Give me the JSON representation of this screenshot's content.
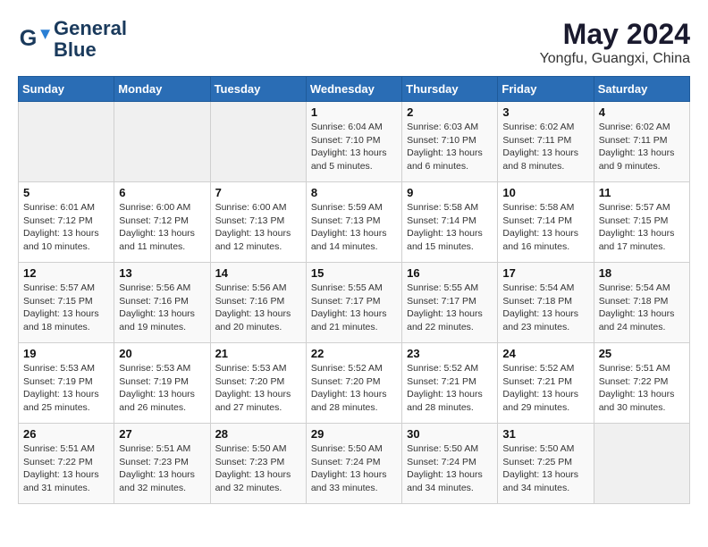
{
  "logo": {
    "line1": "General",
    "line2": "Blue"
  },
  "title": "May 2024",
  "location": "Yongfu, Guangxi, China",
  "days_header": [
    "Sunday",
    "Monday",
    "Tuesday",
    "Wednesday",
    "Thursday",
    "Friday",
    "Saturday"
  ],
  "weeks": [
    [
      {
        "day": "",
        "info": ""
      },
      {
        "day": "",
        "info": ""
      },
      {
        "day": "",
        "info": ""
      },
      {
        "day": "1",
        "info": "Sunrise: 6:04 AM\nSunset: 7:10 PM\nDaylight: 13 hours\nand 5 minutes."
      },
      {
        "day": "2",
        "info": "Sunrise: 6:03 AM\nSunset: 7:10 PM\nDaylight: 13 hours\nand 6 minutes."
      },
      {
        "day": "3",
        "info": "Sunrise: 6:02 AM\nSunset: 7:11 PM\nDaylight: 13 hours\nand 8 minutes."
      },
      {
        "day": "4",
        "info": "Sunrise: 6:02 AM\nSunset: 7:11 PM\nDaylight: 13 hours\nand 9 minutes."
      }
    ],
    [
      {
        "day": "5",
        "info": "Sunrise: 6:01 AM\nSunset: 7:12 PM\nDaylight: 13 hours\nand 10 minutes."
      },
      {
        "day": "6",
        "info": "Sunrise: 6:00 AM\nSunset: 7:12 PM\nDaylight: 13 hours\nand 11 minutes."
      },
      {
        "day": "7",
        "info": "Sunrise: 6:00 AM\nSunset: 7:13 PM\nDaylight: 13 hours\nand 12 minutes."
      },
      {
        "day": "8",
        "info": "Sunrise: 5:59 AM\nSunset: 7:13 PM\nDaylight: 13 hours\nand 14 minutes."
      },
      {
        "day": "9",
        "info": "Sunrise: 5:58 AM\nSunset: 7:14 PM\nDaylight: 13 hours\nand 15 minutes."
      },
      {
        "day": "10",
        "info": "Sunrise: 5:58 AM\nSunset: 7:14 PM\nDaylight: 13 hours\nand 16 minutes."
      },
      {
        "day": "11",
        "info": "Sunrise: 5:57 AM\nSunset: 7:15 PM\nDaylight: 13 hours\nand 17 minutes."
      }
    ],
    [
      {
        "day": "12",
        "info": "Sunrise: 5:57 AM\nSunset: 7:15 PM\nDaylight: 13 hours\nand 18 minutes."
      },
      {
        "day": "13",
        "info": "Sunrise: 5:56 AM\nSunset: 7:16 PM\nDaylight: 13 hours\nand 19 minutes."
      },
      {
        "day": "14",
        "info": "Sunrise: 5:56 AM\nSunset: 7:16 PM\nDaylight: 13 hours\nand 20 minutes."
      },
      {
        "day": "15",
        "info": "Sunrise: 5:55 AM\nSunset: 7:17 PM\nDaylight: 13 hours\nand 21 minutes."
      },
      {
        "day": "16",
        "info": "Sunrise: 5:55 AM\nSunset: 7:17 PM\nDaylight: 13 hours\nand 22 minutes."
      },
      {
        "day": "17",
        "info": "Sunrise: 5:54 AM\nSunset: 7:18 PM\nDaylight: 13 hours\nand 23 minutes."
      },
      {
        "day": "18",
        "info": "Sunrise: 5:54 AM\nSunset: 7:18 PM\nDaylight: 13 hours\nand 24 minutes."
      }
    ],
    [
      {
        "day": "19",
        "info": "Sunrise: 5:53 AM\nSunset: 7:19 PM\nDaylight: 13 hours\nand 25 minutes."
      },
      {
        "day": "20",
        "info": "Sunrise: 5:53 AM\nSunset: 7:19 PM\nDaylight: 13 hours\nand 26 minutes."
      },
      {
        "day": "21",
        "info": "Sunrise: 5:53 AM\nSunset: 7:20 PM\nDaylight: 13 hours\nand 27 minutes."
      },
      {
        "day": "22",
        "info": "Sunrise: 5:52 AM\nSunset: 7:20 PM\nDaylight: 13 hours\nand 28 minutes."
      },
      {
        "day": "23",
        "info": "Sunrise: 5:52 AM\nSunset: 7:21 PM\nDaylight: 13 hours\nand 28 minutes."
      },
      {
        "day": "24",
        "info": "Sunrise: 5:52 AM\nSunset: 7:21 PM\nDaylight: 13 hours\nand 29 minutes."
      },
      {
        "day": "25",
        "info": "Sunrise: 5:51 AM\nSunset: 7:22 PM\nDaylight: 13 hours\nand 30 minutes."
      }
    ],
    [
      {
        "day": "26",
        "info": "Sunrise: 5:51 AM\nSunset: 7:22 PM\nDaylight: 13 hours\nand 31 minutes."
      },
      {
        "day": "27",
        "info": "Sunrise: 5:51 AM\nSunset: 7:23 PM\nDaylight: 13 hours\nand 32 minutes."
      },
      {
        "day": "28",
        "info": "Sunrise: 5:50 AM\nSunset: 7:23 PM\nDaylight: 13 hours\nand 32 minutes."
      },
      {
        "day": "29",
        "info": "Sunrise: 5:50 AM\nSunset: 7:24 PM\nDaylight: 13 hours\nand 33 minutes."
      },
      {
        "day": "30",
        "info": "Sunrise: 5:50 AM\nSunset: 7:24 PM\nDaylight: 13 hours\nand 34 minutes."
      },
      {
        "day": "31",
        "info": "Sunrise: 5:50 AM\nSunset: 7:25 PM\nDaylight: 13 hours\nand 34 minutes."
      },
      {
        "day": "",
        "info": ""
      }
    ]
  ]
}
